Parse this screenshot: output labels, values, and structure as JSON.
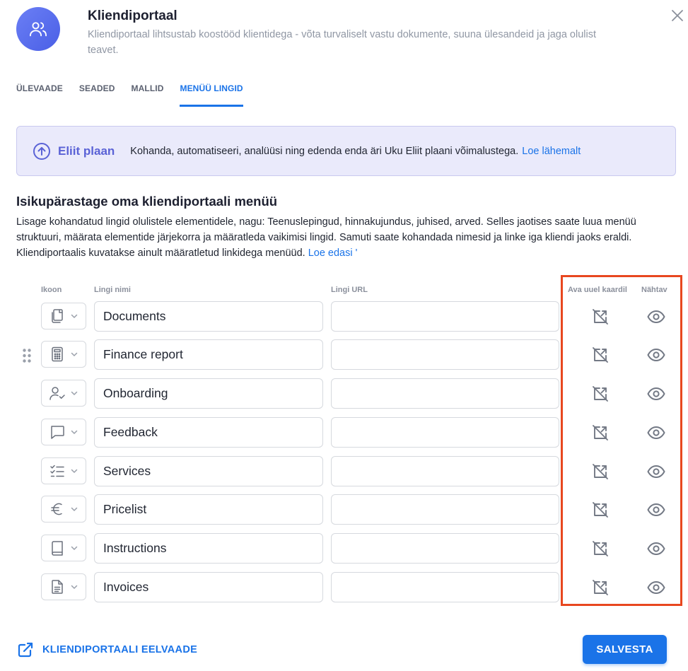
{
  "header": {
    "title": "Kliendiportaal",
    "subtitle": "Kliendiportaal lihtsustab koostööd klientidega - võta turvaliselt vastu dokumente, suuna ülesandeid ja jaga olulist teavet.",
    "avatar_icon": "users-icon",
    "close_icon": "close-icon"
  },
  "tabs": [
    {
      "label": "ÜLEVAADE",
      "active": false
    },
    {
      "label": "SEADED",
      "active": false
    },
    {
      "label": "MALLID",
      "active": false
    },
    {
      "label": "MENÜÜ LINGID",
      "active": true
    }
  ],
  "banner": {
    "icon": "arrow-up-circle-icon",
    "plan_name": "Eliit plaan",
    "text": "Kohanda, automatiseeri, analüüsi ning edenda enda äri Uku Eliit plaani võimalustega.",
    "link": "Loe lähemalt"
  },
  "section": {
    "title": "Isikupärastage oma kliendiportaali menüü",
    "description": "Lisage kohandatud lingid olulistele elementidele, nagu: Teenuslepingud, hinnakujundus, juhised, arved. Selles jaotises saate luua menüü struktuuri, määrata elementide järjekorra ja määratleda vaikimisi lingid. Samuti saate kohandada nimesid ja linke iga kliendi jaoks eraldi. Kliendiportaalis kuvatakse ainult määratletud linkidega menüüd.",
    "link": "Loe edasi '"
  },
  "columns": {
    "icon": "Ikoon",
    "name": "Lingi nimi",
    "url": "Lingi URL",
    "new_tab": "Ava uuel kaardil",
    "visible": "Nähtav"
  },
  "rows": [
    {
      "icon": "documents-icon",
      "name": "Documents",
      "url": "",
      "new_tab": false,
      "visible": true
    },
    {
      "icon": "calculator-icon",
      "name": "Finance report",
      "url": "",
      "new_tab": false,
      "visible": true
    },
    {
      "icon": "user-check-icon",
      "name": "Onboarding",
      "url": "",
      "new_tab": false,
      "visible": true
    },
    {
      "icon": "message-icon",
      "name": "Feedback",
      "url": "",
      "new_tab": false,
      "visible": true
    },
    {
      "icon": "checklist-icon",
      "name": "Services",
      "url": "",
      "new_tab": false,
      "visible": true
    },
    {
      "icon": "euro-icon",
      "name": "Pricelist",
      "url": "",
      "new_tab": false,
      "visible": true
    },
    {
      "icon": "book-icon",
      "name": "Instructions",
      "url": "",
      "new_tab": false,
      "visible": true
    },
    {
      "icon": "invoice-icon",
      "name": "Invoices",
      "url": "",
      "new_tab": false,
      "visible": true
    }
  ],
  "footer": {
    "preview_label": "KLIENDIPORTAALI EELVAADE",
    "preview_icon": "external-link-icon",
    "save_label": "SALVESTA"
  },
  "colors": {
    "accent": "#1a73e8",
    "plan": "#5a62d6",
    "highlight": "#e8471f"
  }
}
